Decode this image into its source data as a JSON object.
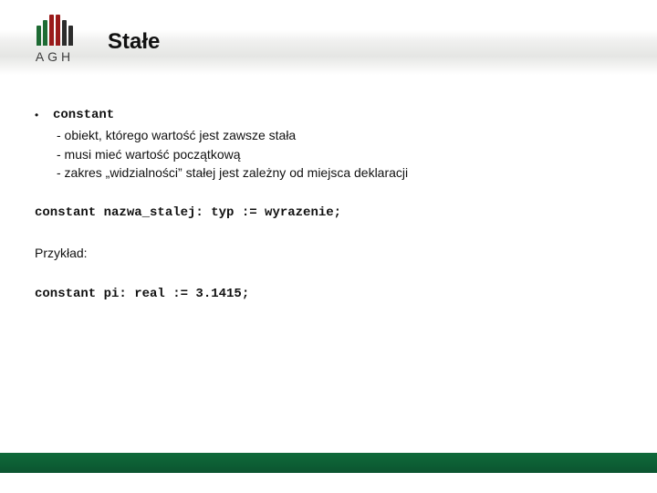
{
  "logo": {
    "text": "AGH"
  },
  "title": "Stałe",
  "bullet": {
    "head": "constant",
    "items": [
      "- obiekt, którego wartość jest zawsze stała",
      "- musi mieć wartość początkową",
      "- zakres „widzialności” stałej jest zależny od miejsca deklaracji"
    ]
  },
  "syntax_line": "constant nazwa_stalej: typ := wyrazenie;",
  "example_label": "Przykład:",
  "example_code": "constant pi: real := 3.1415;"
}
